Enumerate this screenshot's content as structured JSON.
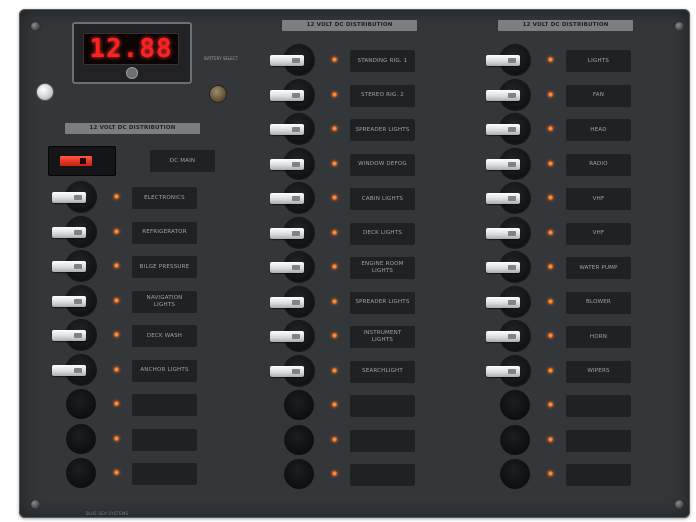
{
  "meter": {
    "reading": "12.88"
  },
  "selector_label": "BATTERY SELECT",
  "sections": {
    "left": "12 VOLT DC DISTRIBUTION",
    "middle": "12 VOLT DC DISTRIBUTION",
    "right": "12 VOLT DC DISTRIBUTION"
  },
  "left_main_label": "DC MAIN",
  "left_column": [
    "ELECTRONICS",
    "REFRIGERATOR",
    "BILGE PRESSURE",
    "NAVIGATION LIGHTS",
    "DECK WASH",
    "ANCHOR LIGHTS",
    "",
    "",
    ""
  ],
  "middle_column": [
    "STANDING RIG. 1",
    "STEREO RIG. 2",
    "SPREADER LIGHTS",
    "WINDOW DEFOG",
    "CABIN LIGHTS",
    "DECK LIGHTS",
    "ENGINE ROOM LIGHTS",
    "SPREADER LIGHTS",
    "INSTRUMENT LIGHTS",
    "SEARCHLIGHT",
    "",
    "",
    ""
  ],
  "right_column": [
    "LIGHTS",
    "FAN",
    "HEAD",
    "RADIO",
    "VHF",
    "VHF",
    "WATER PUMP",
    "BLOWER",
    "HORN",
    "WIPERS",
    "",
    "",
    ""
  ],
  "footer": "BLUE SEA SYSTEMS"
}
